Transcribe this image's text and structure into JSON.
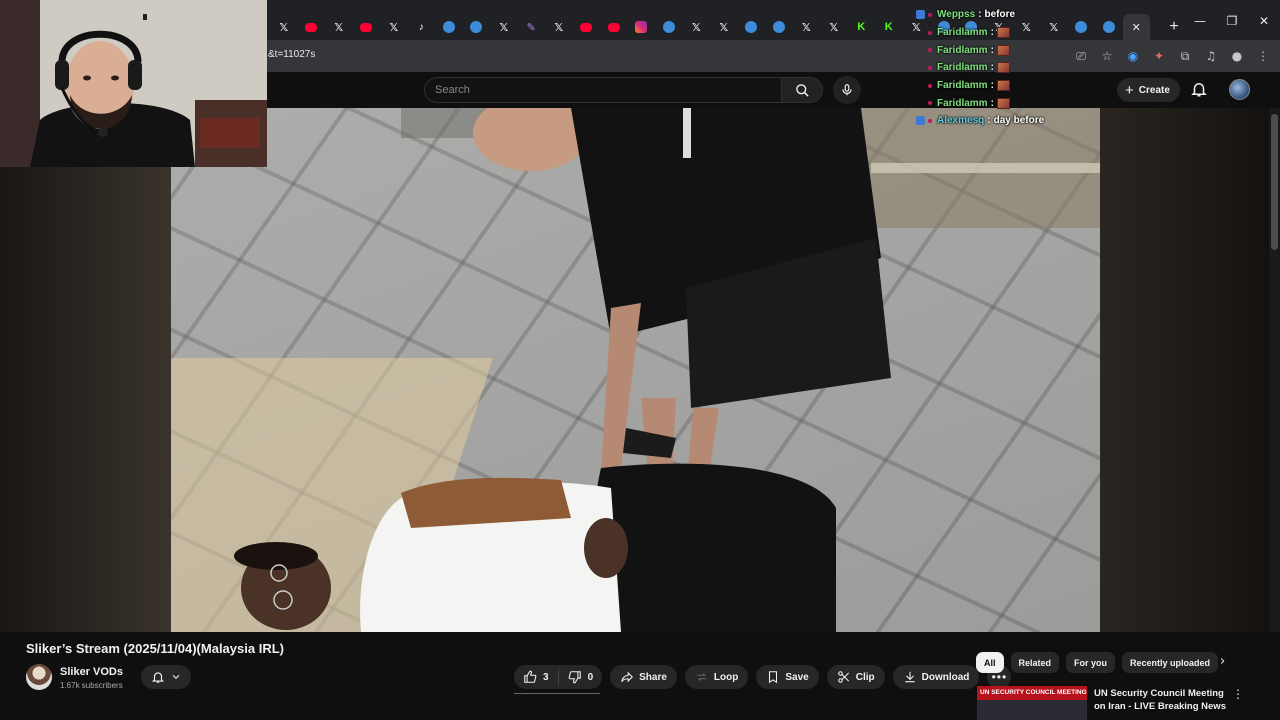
{
  "browser": {
    "tabs": [
      {
        "icon": "x-icon",
        "glyph": "𝕏"
      },
      {
        "icon": "youtube-icon"
      },
      {
        "icon": "x-icon",
        "glyph": "𝕏"
      },
      {
        "icon": "youtube-icon"
      },
      {
        "icon": "x-icon",
        "glyph": "𝕏"
      },
      {
        "icon": "tiktok-icon",
        "glyph": "♪"
      },
      {
        "icon": "twitter-icon"
      },
      {
        "icon": "twitter-icon"
      },
      {
        "icon": "x-icon",
        "glyph": "𝕏"
      },
      {
        "icon": "feather-icon",
        "glyph": "✎"
      },
      {
        "icon": "x-icon",
        "glyph": "𝕏"
      },
      {
        "icon": "youtube-icon"
      },
      {
        "icon": "youtube-icon"
      },
      {
        "icon": "instagram-icon"
      },
      {
        "icon": "twitter-icon"
      },
      {
        "icon": "x-icon",
        "glyph": "𝕏"
      },
      {
        "icon": "x-icon",
        "glyph": "𝕏"
      },
      {
        "icon": "twitter-icon"
      },
      {
        "icon": "twitter-icon"
      },
      {
        "icon": "x-icon",
        "glyph": "𝕏"
      },
      {
        "icon": "x-icon",
        "glyph": "𝕏"
      },
      {
        "icon": "kick-icon",
        "glyph": "K"
      },
      {
        "icon": "kick-icon",
        "glyph": "K"
      },
      {
        "icon": "x-icon",
        "glyph": "𝕏"
      },
      {
        "icon": "twitter-icon"
      },
      {
        "icon": "twitter-icon"
      },
      {
        "icon": "x-icon",
        "glyph": "𝕏"
      },
      {
        "icon": "x-icon",
        "glyph": "𝕏"
      },
      {
        "icon": "x-icon",
        "glyph": "𝕏"
      },
      {
        "icon": "twitter-icon"
      },
      {
        "icon": "twitter-icon"
      },
      {
        "icon": "close-icon",
        "glyph": "✕",
        "active": true
      }
    ],
    "new_tab": "+",
    "window_controls": {
      "minimize": "—",
      "restore": "❐",
      "close": "✕"
    },
    "address_text": "&t=11027s"
  },
  "youtube": {
    "search_placeholder": "Search",
    "create_label": "Create",
    "video": {
      "title": "Sliker’s Stream (2025/11/04)(Malaysia IRL)",
      "channel_name": "Sliker VODs",
      "subscribers": "1.67k subscribers",
      "likes": "3",
      "dislikes": "0",
      "share_label": "Share",
      "loop_label": "Loop",
      "save_label": "Save",
      "clip_label": "Clip",
      "download_label": "Download"
    },
    "chips": [
      {
        "label": "All",
        "active": true
      },
      {
        "label": "Related",
        "active": false
      },
      {
        "label": "For you",
        "active": false
      },
      {
        "label": "Recently uploaded",
        "active": false
      }
    ],
    "recommendation": {
      "thumb_banner": "UN SECURITY COUNCIL MEETING",
      "title": "UN Security Council Meeting on Iran - LIVE Breaking News"
    }
  },
  "chat": [
    {
      "user": "Weppss",
      "message": "before",
      "color": "#7fe07f"
    },
    {
      "user": "Faridlamm",
      "message": "",
      "emote": true,
      "color": "#7fe07f"
    },
    {
      "user": "Faridlamm",
      "message": "",
      "emote": true,
      "color": "#7fe07f"
    },
    {
      "user": "Faridlamm",
      "message": "",
      "emote": true,
      "color": "#7fe07f"
    },
    {
      "user": "Faridlamm",
      "message": "",
      "emote": true,
      "color": "#7fe07f"
    },
    {
      "user": "Faridlamm",
      "message": "",
      "emote": true,
      "color": "#7fe07f"
    },
    {
      "user": "Alexmesq",
      "message": "day before",
      "color": "#5fc8e0"
    }
  ],
  "colors": {
    "background": "#0f0f0f",
    "chip_active": "#f1f1f1",
    "pill": "#272727"
  }
}
